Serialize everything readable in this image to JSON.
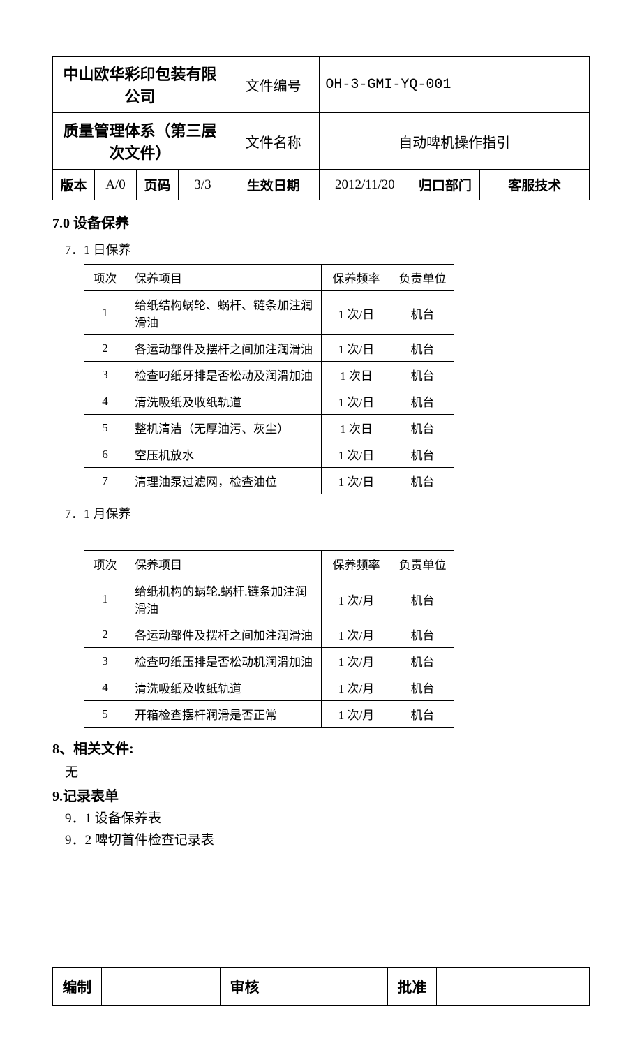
{
  "header": {
    "company": "中山欧华彩印包装有限公司",
    "qms": "质量管理体系（第三层次文件）",
    "doc_code_label": "文件编号",
    "doc_code": "OH-3-GMI-YQ-001",
    "doc_name_label": "文件名称",
    "doc_name": "自动啤机操作指引",
    "version_label": "版本",
    "version": "A/0",
    "page_label": "页码",
    "page": "3/3",
    "eff_date_label": "生效日期",
    "eff_date": "2012/11/20",
    "dept_label": "归口部门",
    "dept": "客服技术"
  },
  "sections": {
    "s7_title": "7.0 设备保养",
    "s7_1_title": "7．1 日保养",
    "s7_2_title": "7．1 月保养",
    "s8_title": "8、相关文件:",
    "s8_none": "无",
    "s9_title": "9.记录表单",
    "s9_1": "9．1 设备保养表",
    "s9_2": "9．2 啤切首件检查记录表"
  },
  "table_headers": {
    "seq": "项次",
    "item": "保养项目",
    "freq": "保养频率",
    "unit": "负责单位"
  },
  "daily": [
    {
      "seq": "1",
      "item": "给纸结构蜗轮、蜗杆、链条加注润滑油",
      "freq": "1 次/日",
      "unit": "机台"
    },
    {
      "seq": "2",
      "item": "各运动部件及摆杆之间加注润滑油",
      "freq": "1 次/日",
      "unit": "机台"
    },
    {
      "seq": "3",
      "item": "检查叼纸牙排是否松动及润滑加油",
      "freq": "1 次日",
      "unit": "机台"
    },
    {
      "seq": "4",
      "item": "清洗吸纸及收纸轨道",
      "freq": "1 次/日",
      "unit": "机台"
    },
    {
      "seq": "5",
      "item": "整机清洁（无厚油污、灰尘）",
      "freq": "1 次日",
      "unit": "机台"
    },
    {
      "seq": "6",
      "item": "空压机放水",
      "freq": "1 次/日",
      "unit": "机台"
    },
    {
      "seq": "7",
      "item": "清理油泵过滤网，检查油位",
      "freq": "1 次/日",
      "unit": "机台"
    }
  ],
  "monthly": [
    {
      "seq": "1",
      "item": "给纸机构的蜗轮.蜗杆.链条加注润滑油",
      "freq": "1 次/月",
      "unit": "机台"
    },
    {
      "seq": "2",
      "item": "各运动部件及摆杆之间加注润滑油",
      "freq": "1 次/月",
      "unit": "机台"
    },
    {
      "seq": "3",
      "item": "检查叼纸压排是否松动机润滑加油",
      "freq": "1 次/月",
      "unit": "机台"
    },
    {
      "seq": "4",
      "item": "清洗吸纸及收纸轨道",
      "freq": "1 次/月",
      "unit": "机台"
    },
    {
      "seq": "5",
      "item": "开箱检查摆杆润滑是否正常",
      "freq": "1 次/月",
      "unit": "机台"
    }
  ],
  "footer": {
    "compile": "编制",
    "review": "审核",
    "approve": "批准"
  }
}
